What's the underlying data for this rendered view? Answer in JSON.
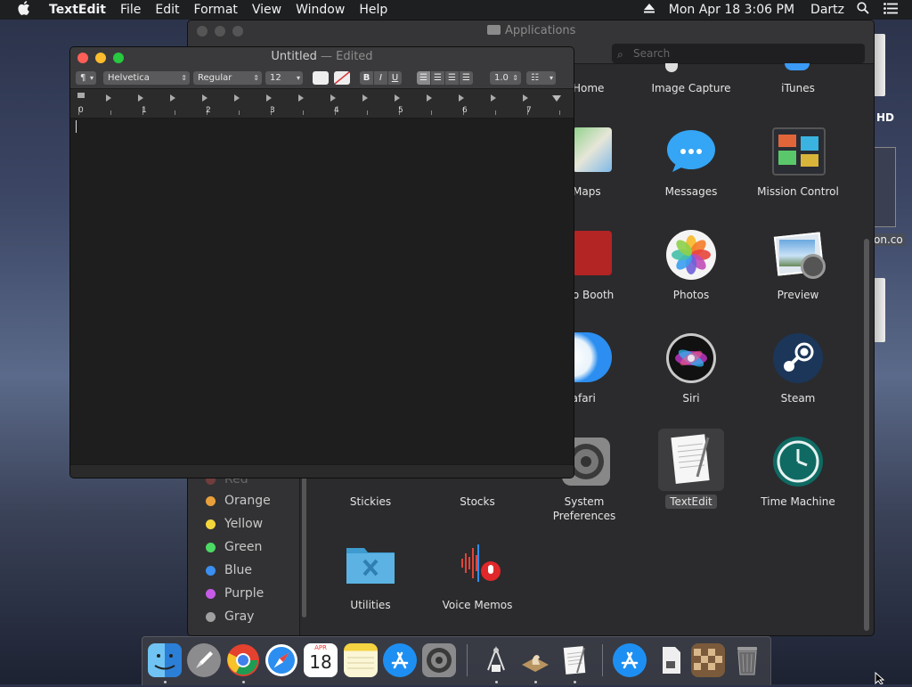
{
  "menubar": {
    "apple": "",
    "app_name": "TextEdit",
    "items": [
      "File",
      "Edit",
      "Format",
      "View",
      "Window",
      "Help"
    ],
    "datetime": "Mon Apr 18  3:06 PM",
    "user": "Dartz"
  },
  "finder": {
    "title": "Applications",
    "search_placeholder": "Search",
    "tags": [
      {
        "label": "Red",
        "color": "#e5534b"
      },
      {
        "label": "Orange",
        "color": "#e9a03b"
      },
      {
        "label": "Yellow",
        "color": "#f3d63c"
      },
      {
        "label": "Green",
        "color": "#4cd964"
      },
      {
        "label": "Blue",
        "color": "#3b8ff0"
      },
      {
        "label": "Purple",
        "color": "#c75be8"
      },
      {
        "label": "Gray",
        "color": "#a0a0a0"
      }
    ],
    "apps": {
      "home": "Home",
      "image_capture": "Image Capture",
      "itunes": "iTunes",
      "maps": "Maps",
      "messages": "Messages",
      "mission_control": "Mission Control",
      "photo_booth": "Photo Booth",
      "photos": "Photos",
      "preview": "Preview",
      "safari": "Safari",
      "siri": "Siri",
      "steam": "Steam",
      "stickies": "Stickies",
      "stocks": "Stocks",
      "system_preferences": "System\nPreferences",
      "textedit": "TextEdit",
      "time_machine": "Time Machine",
      "utilities": "Utilities",
      "voice_memos": "Voice Memos"
    }
  },
  "desktop": {
    "hd_label": "HD",
    "file_label": "on.co"
  },
  "textedit": {
    "title": "Untitled",
    "edited": "— Edited",
    "paragraph_style": "¶",
    "font_family": "Helvetica",
    "font_style": "Regular",
    "font_size": "12",
    "bold": "B",
    "italic": "I",
    "underline": "U",
    "line_spacing": "1.0",
    "ruler_numbers": [
      "0",
      "1",
      "2",
      "3",
      "4",
      "5",
      "6",
      "7"
    ]
  },
  "dock": {
    "calendar_month": "APR",
    "calendar_day": "18",
    "items": [
      "Finder",
      "Launchpad",
      "Google Chrome",
      "Safari",
      "Calendar",
      "Notes",
      "App Store",
      "System Preferences",
      "Directory Utility",
      "Chess",
      "TextEdit",
      "Applications",
      "File",
      "Chess Board",
      "Trash"
    ]
  },
  "colors": {
    "menubar": "#1e1f21",
    "close": "#ff5f57",
    "minimize": "#febc2e",
    "zoom": "#28c840"
  }
}
